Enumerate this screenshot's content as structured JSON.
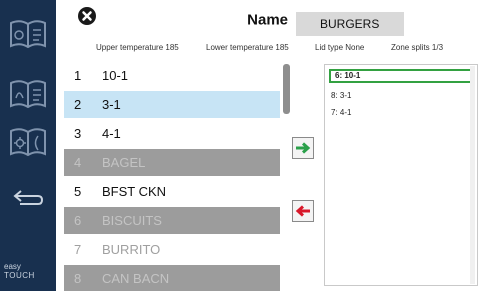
{
  "sidebar": {
    "buttons": [
      {
        "name": "menu-book-icon"
      },
      {
        "name": "recipe-book-icon"
      },
      {
        "name": "settings-book-icon"
      },
      {
        "name": "back-arrow-icon"
      }
    ],
    "logo_line1": "easy",
    "logo_line2": "TOUCH"
  },
  "header": {
    "name_label": "Name",
    "name_value": "BURGERS"
  },
  "info": {
    "upper_temp": "Upper temperature 185",
    "lower_temp": "Lower temperature 185",
    "lid_type": "Lid type None",
    "zone_splits": "Zone splits 1/3"
  },
  "products": [
    {
      "num": "1",
      "label": "10-1",
      "state": "normal"
    },
    {
      "num": "2",
      "label": "3-1",
      "state": "selected"
    },
    {
      "num": "3",
      "label": "4-1",
      "state": "normal"
    },
    {
      "num": "4",
      "label": "BAGEL",
      "state": "disabled"
    },
    {
      "num": "5",
      "label": "BFST CKN",
      "state": "normal"
    },
    {
      "num": "6",
      "label": "BISCUITS",
      "state": "disabled"
    },
    {
      "num": "7",
      "label": "BURRITO",
      "state": "dim"
    },
    {
      "num": "8",
      "label": "CAN BACN",
      "state": "disabled"
    }
  ],
  "zone_items": [
    {
      "label": "6: 10-1",
      "active": true
    },
    {
      "label": "8: 3-1",
      "active": false
    },
    {
      "label": "7: 4-1",
      "active": false
    }
  ],
  "colors": {
    "sidebar": "#18304f",
    "selected_row": "#c7e4f5",
    "disabled_row": "#9c9c9c",
    "add_arrow": "#2aa04a",
    "remove_arrow": "#d8182a",
    "active_zone_border": "#33a141"
  }
}
